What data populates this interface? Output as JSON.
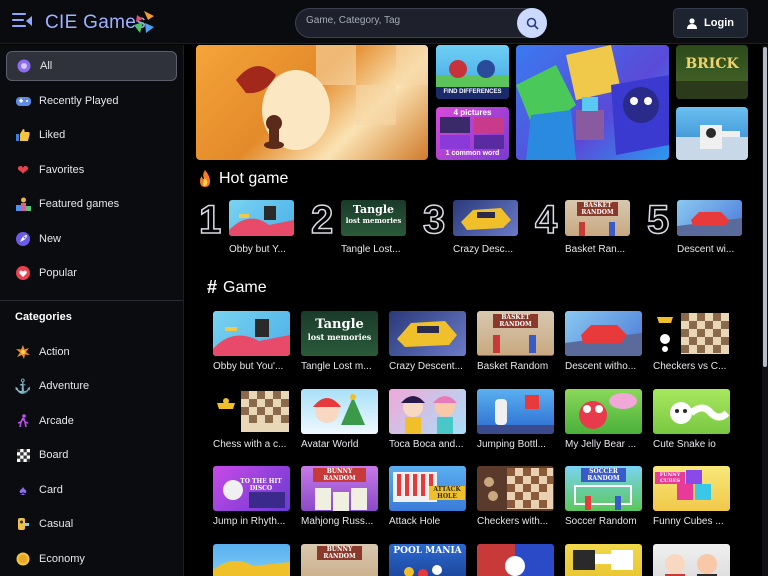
{
  "header": {
    "brand": "CIE Games",
    "search_placeholder": "Game, Category, Tag",
    "login_label": "Login"
  },
  "sidebar": {
    "items": [
      {
        "label": "All",
        "icon": "all-icon"
      },
      {
        "label": "Recently Played",
        "icon": "gamepad-icon"
      },
      {
        "label": "Liked",
        "icon": "thumbs-up-icon"
      },
      {
        "label": "Favorites",
        "icon": "heart-icon"
      },
      {
        "label": "Featured games",
        "icon": "podium-icon"
      },
      {
        "label": "New",
        "icon": "rocket-icon"
      },
      {
        "label": "Popular",
        "icon": "popular-heart-icon"
      }
    ],
    "categories_title": "Categories",
    "categories": [
      {
        "label": "Action",
        "icon": "explosion-icon"
      },
      {
        "label": "Adventure",
        "icon": "anchor-icon"
      },
      {
        "label": "Arcade",
        "icon": "runner-icon"
      },
      {
        "label": "Board",
        "icon": "checkerboard-icon"
      },
      {
        "label": "Card",
        "icon": "spade-icon"
      },
      {
        "label": "Casual",
        "icon": "casual-icon"
      },
      {
        "label": "Economy",
        "icon": "coin-icon"
      }
    ]
  },
  "banners": {
    "find_differences": "FIND DIFFERENCES",
    "pictures_top": "4 pictures",
    "pictures_bottom": "1 common word",
    "brick_text": "BRICK"
  },
  "hot": {
    "title": "Hot game",
    "items": [
      {
        "rank": "1",
        "label": "Obby but Y..."
      },
      {
        "rank": "2",
        "label": "Tangle Lost..."
      },
      {
        "rank": "3",
        "label": "Crazy Desc..."
      },
      {
        "rank": "4",
        "label": "Basket Ran..."
      },
      {
        "rank": "5",
        "label": "Descent wi..."
      }
    ]
  },
  "games": {
    "title": "Game",
    "thumb_text": {
      "tangle_top": "Tangle",
      "tangle_bottom": "lost memories",
      "basket": "BASKET RANDOM",
      "disco": "TO THE HIT DISCO",
      "mahjong": "BUNNY RANDOM",
      "attack": "ATTACK HOLE",
      "soccer": "SOCCER RANDOM",
      "cubes": "FUNNY CUBES",
      "pool": "POOL MANIA"
    },
    "items": [
      {
        "label": "Obby but You'..."
      },
      {
        "label": "Tangle Lost m..."
      },
      {
        "label": "Crazy Descent..."
      },
      {
        "label": "Basket Random"
      },
      {
        "label": "Descent witho..."
      },
      {
        "label": "Checkers vs C..."
      },
      {
        "label": "Chess with a c..."
      },
      {
        "label": "Avatar World"
      },
      {
        "label": "Toca Boca and..."
      },
      {
        "label": "Jumping Bottl..."
      },
      {
        "label": "My Jelly Bear ..."
      },
      {
        "label": "Cute Snake io"
      },
      {
        "label": "Jump in Rhyth..."
      },
      {
        "label": "Mahjong Russ..."
      },
      {
        "label": "Attack Hole"
      },
      {
        "label": "Checkers with..."
      },
      {
        "label": "Soccer Random"
      },
      {
        "label": "Funny Cubes ..."
      },
      {
        "label": ""
      },
      {
        "label": ""
      },
      {
        "label": ""
      },
      {
        "label": ""
      },
      {
        "label": ""
      },
      {
        "label": ""
      }
    ]
  },
  "colors": {
    "accent": "#9fb1ff",
    "background": "#000000",
    "sidebar": "#0b0c10",
    "active_item": "#2f323a"
  }
}
